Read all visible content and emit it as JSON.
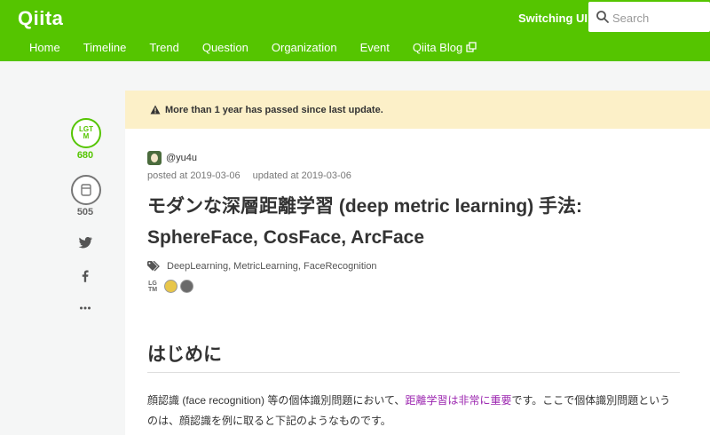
{
  "header": {
    "logo": "Qiita",
    "switching_ui": "Switching UI",
    "search_placeholder": "Search",
    "nav": [
      "Home",
      "Timeline",
      "Trend",
      "Question",
      "Organization",
      "Event",
      "Qiita Blog"
    ]
  },
  "sidebar": {
    "lgtm_label": "LGTM",
    "lgtm_count": "680",
    "stock_count": "505",
    "share_icons": [
      "twitter-icon",
      "facebook-icon",
      "more-icon"
    ]
  },
  "notice": {
    "text": "More than 1 year has passed since last update."
  },
  "article": {
    "author": "@yu4u",
    "posted": "posted at 2019-03-06",
    "updated": "updated at 2019-03-06",
    "title": "モダンな深層距離学習 (deep metric learning) 手法: SphereFace, CosFace, ArcFace",
    "tags": [
      "DeepLearning,",
      "MetricLearning,",
      "FaceRecognition"
    ],
    "lgtm_small": "LGTM",
    "section_heading": "はじめに",
    "paragraph_before_link": "顔認識 (face recognition) 等の個体識別問題において、",
    "paragraph_link": "距離学習は非常に重要",
    "paragraph_after_link": "です。ここで個体識別問題というのは、顔認識を例に取ると下記のようなものです。"
  },
  "colors": {
    "brand": "#55c500",
    "notice_bg": "#fcf0c8",
    "link": "#9c27b0"
  }
}
